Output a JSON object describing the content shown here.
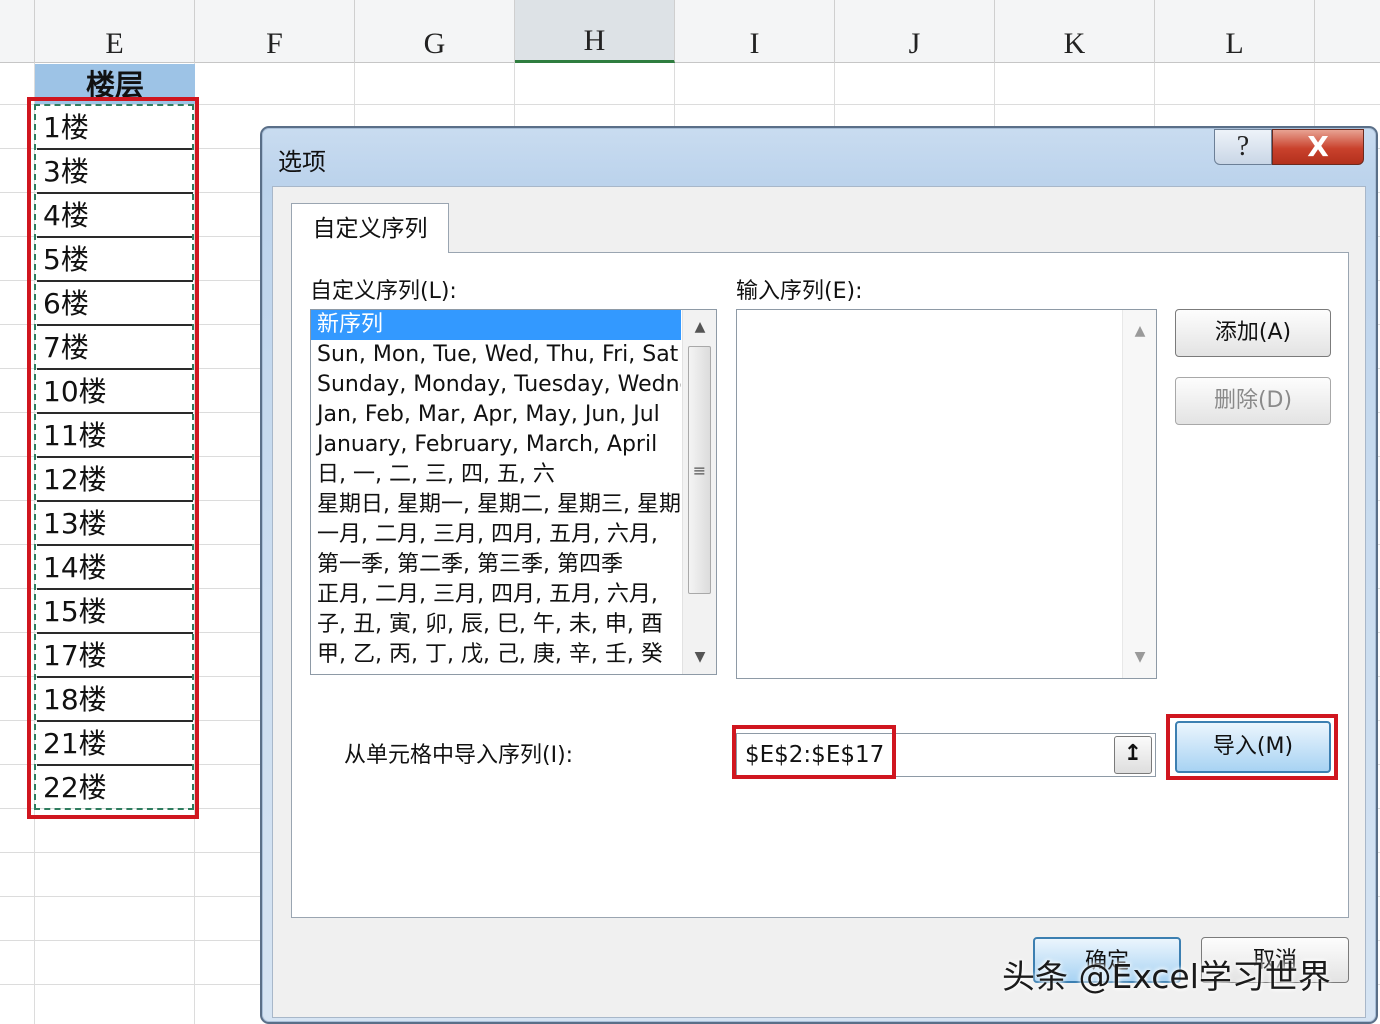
{
  "sheet": {
    "columns": [
      "E",
      "F",
      "G",
      "H",
      "I",
      "J",
      "K",
      "L"
    ],
    "selected_column": "H",
    "header_cell": "楼层",
    "floors": [
      "1楼",
      "3楼",
      "4楼",
      "5楼",
      "6楼",
      "7楼",
      "10楼",
      "11楼",
      "12楼",
      "13楼",
      "14楼",
      "15楼",
      "17楼",
      "18楼",
      "21楼",
      "22楼"
    ]
  },
  "dialog": {
    "title": "选项",
    "help_label": "?",
    "close_label": "X",
    "tab_label": "自定义序列",
    "lists_label": "自定义序列(L):",
    "entries_label": "输入序列(E):",
    "lists": [
      "新序列",
      "Sun, Mon, Tue, Wed, Thu, Fri, Sat",
      "Sunday, Monday, Tuesday, Wednesday",
      "Jan, Feb, Mar, Apr, May, Jun, Jul",
      "January, February, March, April",
      "日, 一, 二, 三, 四, 五, 六",
      "星期日, 星期一, 星期二, 星期三, 星期四",
      "一月, 二月, 三月, 四月, 五月, 六月,",
      "第一季, 第二季, 第三季, 第四季",
      "正月, 二月, 三月, 四月, 五月, 六月,",
      "子, 丑, 寅, 卯, 辰, 巳, 午, 未, 申, 酉",
      "甲, 乙, 丙, 丁, 戊, 己, 庚, 辛, 壬, 癸"
    ],
    "selected_list_index": 0,
    "add_button": "添加(A)",
    "delete_button": "删除(D)",
    "import_label": "从单元格中导入序列(I):",
    "import_value": "$E$2:$E$17",
    "collapse_icon": "↥",
    "import_button": "导入(M)",
    "ok_button": "确定",
    "cancel_button": "取消"
  },
  "watermark": "头条 @Excel学习世界",
  "colors": {
    "highlight_red": "#d0161f",
    "selection_blue": "#3399ff",
    "header_fill": "#9dc3e6"
  }
}
